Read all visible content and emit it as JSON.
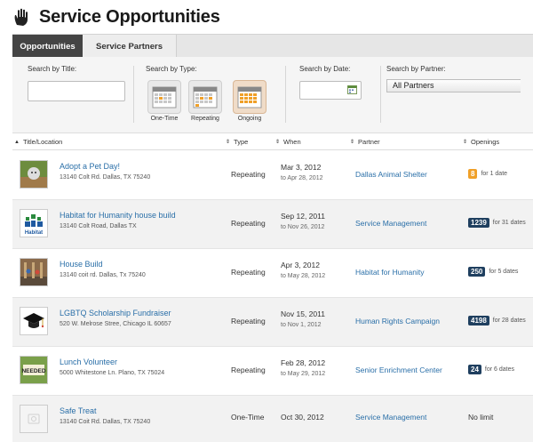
{
  "page": {
    "title": "Service Opportunities"
  },
  "tabs": [
    {
      "label": "Opportunities",
      "active": true
    },
    {
      "label": "Service Partners",
      "active": false
    }
  ],
  "filters": {
    "title": {
      "label": "Search by Title:",
      "value": "",
      "placeholder": ""
    },
    "type": {
      "label": "Search by Type:",
      "options": [
        "One-Time",
        "Repeating",
        "Ongoing"
      ]
    },
    "date": {
      "label": "Search by Date:",
      "value": ""
    },
    "partner": {
      "label": "Search by Partner:",
      "selected": "All Partners"
    }
  },
  "table": {
    "headers": {
      "title": "Title/Location",
      "type": "Type",
      "when": "When",
      "partner": "Partner",
      "openings": "Openings"
    },
    "rows": [
      {
        "title": "Adopt a Pet Day!",
        "location": "13140 Colt Rd. Dallas, TX 75240",
        "type": "Repeating",
        "when": "Mar 3, 2012",
        "when_end": "to Apr 28, 2012",
        "partner": "Dallas Animal Shelter",
        "openings_badge": "8",
        "openings_text": "for 1 date",
        "thumb_icon": "pet-photo-icon"
      },
      {
        "title": "Habitat for Humanity house build",
        "location": "13140 Colt Road, Dallas TX",
        "type": "Repeating",
        "when": "Sep 12, 2011",
        "when_end": "to Nov 26, 2012",
        "partner": "Service Management",
        "openings_badge": "1239",
        "openings_text": "for 31 dates",
        "thumb_icon": "habitat-logo-icon",
        "thumb_text": "Habitat"
      },
      {
        "title": "House Build",
        "location": "13140 coit rd. Dallas, Tx 75240",
        "type": "Repeating",
        "when": "Apr 3, 2012",
        "when_end": "to May 28, 2012",
        "partner": "Habitat for Humanity",
        "openings_badge": "250",
        "openings_text": "for 5 dates",
        "thumb_icon": "house-build-photo-icon"
      },
      {
        "title": "LGBTQ Scholarship Fundraiser",
        "location": "520 W. Melrose Stree, Chicago IL 60657",
        "type": "Repeating",
        "when": "Nov 15, 2011",
        "when_end": "to Nov 1, 2012",
        "partner": "Human Rights Campaign",
        "openings_badge": "4198",
        "openings_text": "for 28 dates",
        "thumb_icon": "graduation-cap-icon"
      },
      {
        "title": "Lunch Volunteer",
        "location": "5000 Whitestone Ln. Plano, TX 75024",
        "type": "Repeating",
        "when": "Feb 28, 2012",
        "when_end": "to May 29, 2012",
        "partner": "Senior Enrichment Center",
        "openings_badge": "24",
        "openings_text": "for 6 dates",
        "thumb_icon": "needed-sign-icon",
        "thumb_text": "NEEDED"
      },
      {
        "title": "Safe Treat",
        "location": "13140 Coit Rd. Dallas, TX 75240",
        "type": "One-Time",
        "when": "Oct 30, 2012",
        "when_end": "",
        "partner": "Service Management",
        "openings_badge": "",
        "openings_text": "No limit",
        "thumb_icon": "placeholder-image-icon"
      }
    ]
  },
  "colors": {
    "link": "#2a6fa8",
    "badge": "#1f3f5f",
    "badge_small": "#f0a028",
    "active_tab": "#444444"
  }
}
